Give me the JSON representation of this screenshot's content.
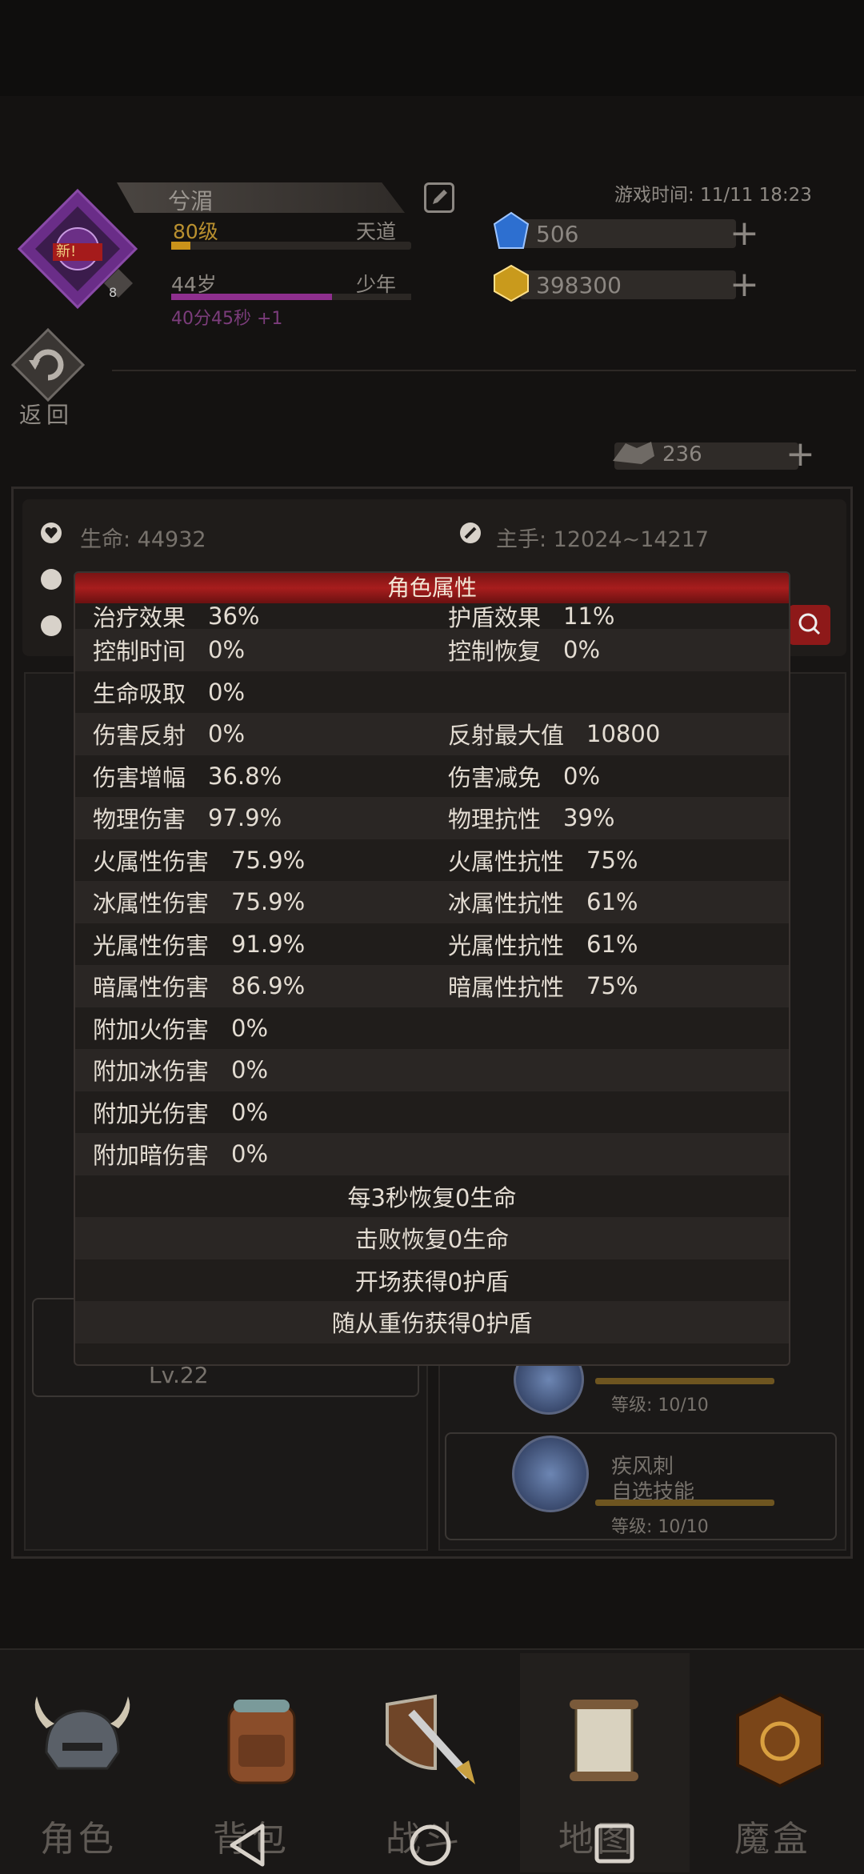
{
  "player": {
    "name": "兮湄",
    "badge": "新!",
    "rank": "8",
    "level": "80级",
    "realm": "天道",
    "level_progress": 0.08,
    "age": "44岁",
    "age_stage": "少年",
    "age_progress": 0.67,
    "timer": "40分45秒 +1"
  },
  "game_time": "游戏时间: 11/11 18:23",
  "resources": [
    {
      "name": "blue-gem",
      "value": "506"
    },
    {
      "name": "gold-gem",
      "value": "398300"
    }
  ],
  "stamina": "236",
  "back_label": "返回",
  "background_stats": {
    "life": "生命: 44932",
    "main_hand": "主手: 12024~14217",
    "level_text": "Lv.22",
    "skills": [
      {
        "grade": "等级: 10/10"
      },
      {
        "name": "疾风刺",
        "tag": "自选技能",
        "grade": "等级: 10/10"
      }
    ]
  },
  "modal": {
    "title": "角色属性",
    "pair_rows": [
      {
        "l": "治疗效果",
        "lv": "36%",
        "r": "护盾效果",
        "rv": "11%"
      },
      {
        "l": "控制时间",
        "lv": "0%",
        "r": "控制恢复",
        "rv": "0%"
      },
      {
        "l": "生命吸取",
        "lv": "0%",
        "r": "",
        "rv": ""
      },
      {
        "l": "伤害反射",
        "lv": "0%",
        "r": "反射最大值",
        "rv": "10800"
      },
      {
        "l": "伤害增幅",
        "lv": "36.8%",
        "r": "伤害减免",
        "rv": "0%"
      },
      {
        "l": "物理伤害",
        "lv": "97.9%",
        "r": "物理抗性",
        "rv": "39%"
      },
      {
        "l": "火属性伤害",
        "lv": "75.9%",
        "r": "火属性抗性",
        "rv": "75%"
      },
      {
        "l": "冰属性伤害",
        "lv": "75.9%",
        "r": "冰属性抗性",
        "rv": "61%"
      },
      {
        "l": "光属性伤害",
        "lv": "91.9%",
        "r": "光属性抗性",
        "rv": "61%"
      },
      {
        "l": "暗属性伤害",
        "lv": "86.9%",
        "r": "暗属性抗性",
        "rv": "75%"
      },
      {
        "l": "附加火伤害",
        "lv": "0%",
        "r": "",
        "rv": ""
      },
      {
        "l": "附加冰伤害",
        "lv": "0%",
        "r": "",
        "rv": ""
      },
      {
        "l": "附加光伤害",
        "lv": "0%",
        "r": "",
        "rv": ""
      },
      {
        "l": "附加暗伤害",
        "lv": "0%",
        "r": "",
        "rv": ""
      }
    ],
    "center_rows": [
      "每3秒恢复0生命",
      "击败恢复0生命",
      "开场获得0护盾",
      "随从重伤获得0护盾"
    ]
  },
  "nav": [
    {
      "label": "角色",
      "icon": "helmet-icon"
    },
    {
      "label": "背包",
      "icon": "backpack-icon"
    },
    {
      "label": "战斗",
      "icon": "sword-shield-icon"
    },
    {
      "label": "地图",
      "icon": "scroll-map-icon"
    },
    {
      "label": "魔盒",
      "icon": "magic-box-icon"
    }
  ],
  "colors": {
    "accent_red": "#a71d1d",
    "gold": "#c9921a",
    "purple": "#8e2f8e"
  }
}
